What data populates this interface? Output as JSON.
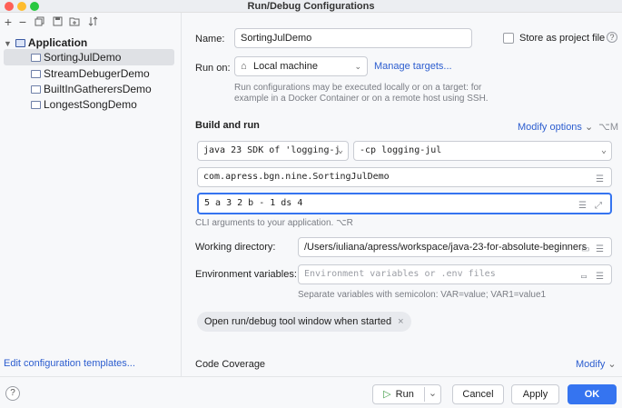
{
  "window": {
    "title": "Run/Debug Configurations"
  },
  "tree": {
    "root": "Application",
    "items": [
      "SortingJulDemo",
      "StreamDebugerDemo",
      "BuiltInGatherersDemo",
      "LongestSongDemo"
    ]
  },
  "left": {
    "edit_templates": "Edit configuration templates..."
  },
  "form": {
    "name_label": "Name:",
    "name_value": "SortingJulDemo",
    "store_label": "Store as project file",
    "run_on_label": "Run on:",
    "run_on_value": "Local machine",
    "manage_targets": "Manage targets...",
    "run_on_hint": "Run configurations may be executed locally or on a target: for example in a Docker Container or on a remote host using SSH.",
    "build_run_title": "Build and run",
    "modify_options": "Modify options",
    "modify_shortcut": "⌥M",
    "jdk_value": "java 23 SDK of 'logging-j",
    "cp_value": "-cp logging-jul",
    "main_class": "com.apress.bgn.nine.SortingJulDemo",
    "program_args": "5 a 3 2 b - 1 ds 4",
    "cli_hint": "CLI arguments to your application. ⌥R",
    "workdir_label": "Working directory:",
    "workdir_value": "/Users/iuliana/apress/workspace/java-23-for-absolute-beginners",
    "env_label": "Environment variables:",
    "env_placeholder": "Environment variables or .env files",
    "env_hint": "Separate variables with semicolon: VAR=value; VAR1=value1",
    "chip_label": "Open run/debug tool window when started",
    "code_coverage": "Code Coverage",
    "modify": "Modify"
  },
  "buttons": {
    "help": "?",
    "run": "Run",
    "cancel": "Cancel",
    "apply": "Apply",
    "ok": "OK"
  }
}
